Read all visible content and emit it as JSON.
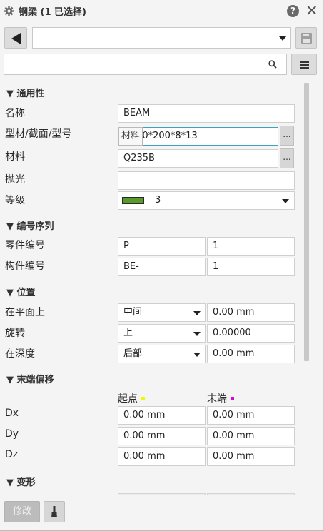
{
  "header": {
    "title": "钢梁 (1 已选择)",
    "help_label": "?",
    "close_label": "✕"
  },
  "toolbar": {
    "attribute_set_value": "",
    "search_value": "",
    "search_placeholder": ""
  },
  "sections": {
    "general": "▼ 通用性",
    "numbering": "▼ 编号序列",
    "position": "▼ 位置",
    "end_offset": "▼ 末端偏移",
    "deform": "▼ 变形"
  },
  "general": {
    "name_label": "名称",
    "name_value": "BEAM",
    "profile_label": "型材/截面/型号",
    "profile_value": "H400*200*8*13",
    "material_label": "材料",
    "material_value": "Q235B",
    "finish_label": "抛光",
    "finish_value": "",
    "class_label": "等级",
    "class_value": "3",
    "class_color": "#5a9a2a",
    "tooltip_text": "材料",
    "ellipsis": "..."
  },
  "numbering": {
    "part_label": "零件编号",
    "part_prefix": "P",
    "part_start": "1",
    "assembly_label": "构件编号",
    "assembly_prefix": "BE-",
    "assembly_start": "1"
  },
  "position": {
    "plane_label": "在平面上",
    "plane_option": "中间",
    "plane_value": "0.00 mm",
    "rotation_label": "旋转",
    "rotation_option": "上",
    "rotation_value": "0.00000",
    "depth_label": "在深度",
    "depth_option": "后部",
    "depth_value": "0.00 mm"
  },
  "end_offset": {
    "start_header": "起点",
    "end_header": "末端",
    "start_color": "#f5f500",
    "end_color": "#e000e0",
    "dx_label": "Dx",
    "dx_start": "0.00 mm",
    "dx_end": "0.00 mm",
    "dy_label": "Dy",
    "dy_start": "0.00 mm",
    "dy_end": "0.00 mm",
    "dz_label": "Dz",
    "dz_start": "0.00 mm",
    "dz_end": "0.00 mm"
  },
  "footer": {
    "modify_label": "修改"
  }
}
